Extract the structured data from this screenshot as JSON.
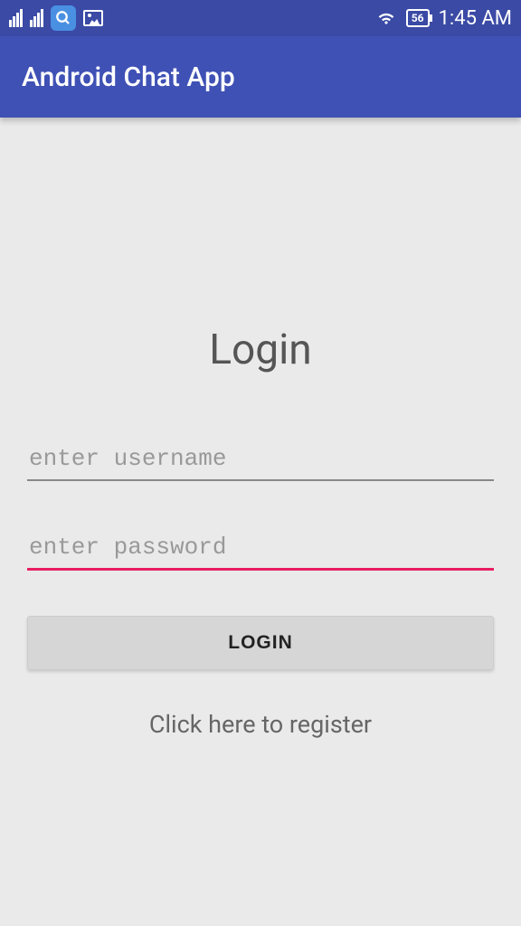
{
  "statusBar": {
    "batteryLevel": "56",
    "time": "1:45 AM"
  },
  "appBar": {
    "title": "Android Chat App"
  },
  "login": {
    "heading": "Login",
    "usernamePlaceholder": "enter username",
    "passwordPlaceholder": "enter password",
    "buttonLabel": "LOGIN",
    "registerText": "Click here to register"
  }
}
